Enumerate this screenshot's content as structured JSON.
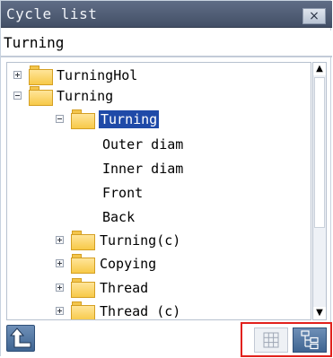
{
  "window": {
    "title": "Cycle list",
    "close_label": "×"
  },
  "path": {
    "value": "Turning"
  },
  "tree": {
    "items": [
      {
        "label": "TurningHol",
        "toggle": "+"
      },
      {
        "label": "Turning",
        "toggle": "-"
      },
      {
        "label": "Turning",
        "toggle": "-",
        "selected": true
      },
      {
        "label": "Outer diam"
      },
      {
        "label": "Inner diam"
      },
      {
        "label": "Front"
      },
      {
        "label": "Back"
      },
      {
        "label": "Turning(c)",
        "toggle": "+"
      },
      {
        "label": "Copying",
        "toggle": "+"
      },
      {
        "label": "Thread",
        "toggle": "+"
      },
      {
        "label": "Thread (c)",
        "toggle": "+"
      }
    ]
  },
  "scrollbar": {
    "up_arrow": "▲",
    "down_arrow": "▼"
  },
  "colors": {
    "selection": "#1f4aa8",
    "highlight_border": "#e2211c",
    "titlebar": "#4f5b72"
  },
  "icons": {
    "up": "up-arrow-icon",
    "grid": "grid-view-icon",
    "tree": "tree-view-icon"
  }
}
